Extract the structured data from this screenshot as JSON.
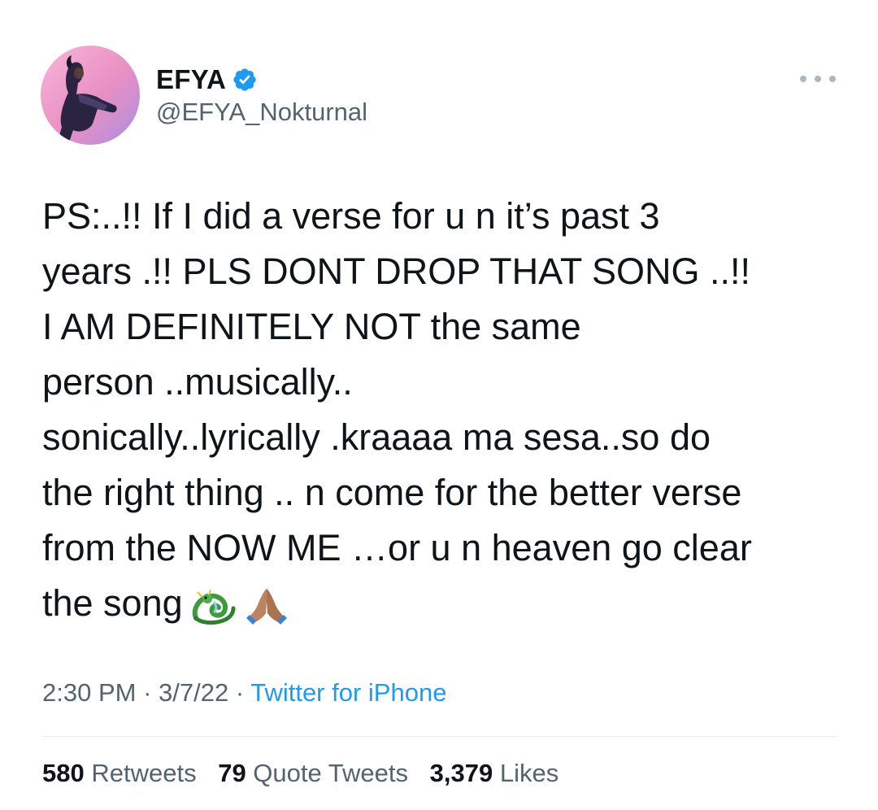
{
  "user": {
    "display_name": "EFYA",
    "handle": "@EFYA_Nokturnal",
    "verified": true,
    "avatar_icon": "profile-photo-avatar"
  },
  "more_icon": "more-horizontal-icon",
  "tweet": {
    "lines": [
      "PS:..!! If I did a verse for u n it’s past 3",
      "years .!! PLS DONT DROP THAT SONG ..!!",
      "I AM DEFINITELY NOT  the same",
      "person ..musically..",
      "sonically..lyrically .kraaaa ma sesa..so do",
      "the right thing .. n come for the better verse",
      "from the NOW ME …or u n heaven go clear",
      "the song"
    ],
    "emojis": [
      "dragon-emoji",
      "folded-hands-emoji"
    ]
  },
  "meta": {
    "time": "2:30 PM",
    "sep1": " · ",
    "date": "3/7/22",
    "sep2": " · ",
    "source": "Twitter for iPhone"
  },
  "stats": {
    "retweets_count": "580",
    "retweets_label": " Retweets",
    "quotes_count": "79",
    "quotes_label": " Quote Tweets",
    "likes_count": "3,379",
    "likes_label": " Likes"
  },
  "colors": {
    "text_primary": "#0f1419",
    "text_secondary": "#536471",
    "link": "#1d9bf0",
    "verified": "#1d9bf0",
    "divider": "#e6ecf0"
  }
}
